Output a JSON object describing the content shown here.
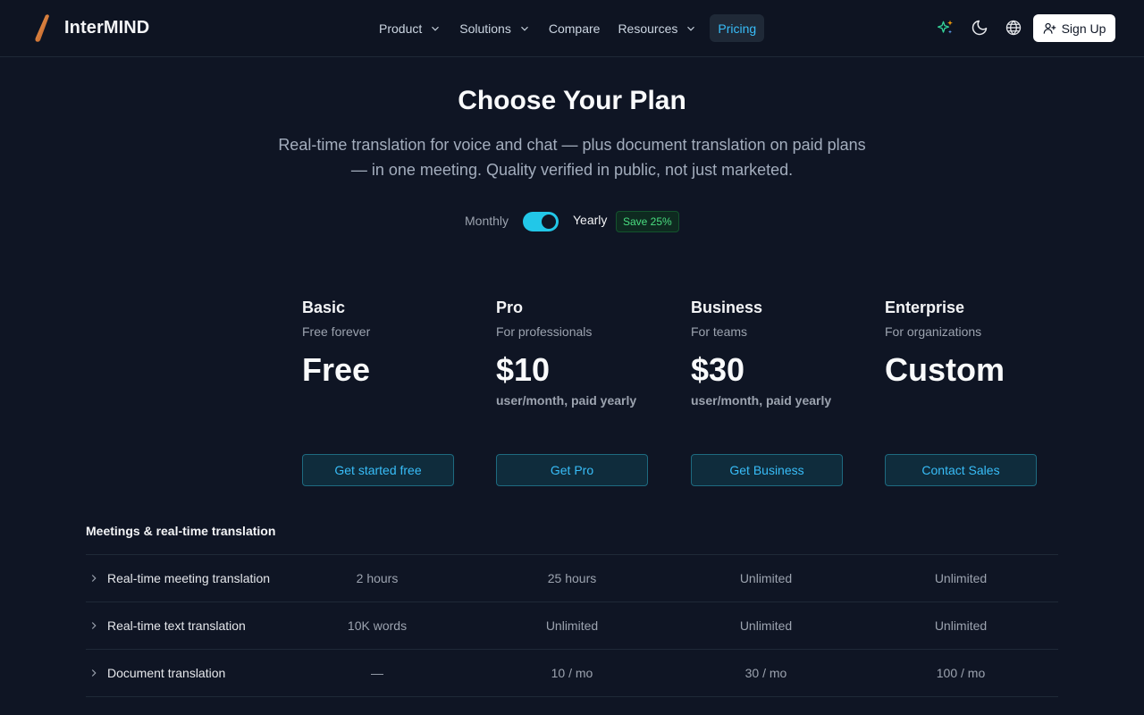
{
  "header": {
    "brand": "InterMIND",
    "nav": [
      {
        "label": "Product",
        "dropdown": true
      },
      {
        "label": "Solutions",
        "dropdown": true
      },
      {
        "label": "Compare",
        "dropdown": false
      },
      {
        "label": "Resources",
        "dropdown": true
      },
      {
        "label": "Pricing",
        "dropdown": false,
        "active": true
      }
    ],
    "icons": [
      "sparkles-icon",
      "moon-icon",
      "globe-icon"
    ],
    "signup_label": "Sign Up"
  },
  "hero": {
    "title": "Choose Your Plan",
    "subtitle_line1": "Real-time translation for voice and chat — plus document translation on paid plans",
    "subtitle_line2": "— in one meeting. Quality verified in public, not just marketed."
  },
  "billing": {
    "monthly_label": "Monthly",
    "yearly_label": "Yearly",
    "save_badge": "Save 25%",
    "yearly_selected": true
  },
  "plans": [
    {
      "name": "Basic",
      "desc": "Free forever",
      "price": "Free",
      "period": "",
      "cta": "Get started free"
    },
    {
      "name": "Pro",
      "desc": "For professionals",
      "price": "$10",
      "period": "user/month, paid yearly",
      "cta": "Get Pro"
    },
    {
      "name": "Business",
      "desc": "For teams",
      "price": "$30",
      "period": "user/month, paid yearly",
      "cta": "Get Business"
    },
    {
      "name": "Enterprise",
      "desc": "For organizations",
      "price": "Custom",
      "period": "",
      "cta": "Contact Sales"
    }
  ],
  "features": {
    "section_title": "Meetings & real-time translation",
    "rows": [
      {
        "label": "Real-time meeting translation",
        "values": [
          "2 hours",
          "25 hours",
          "Unlimited",
          "Unlimited"
        ]
      },
      {
        "label": "Real-time text translation",
        "values": [
          "10K words",
          "Unlimited",
          "Unlimited",
          "Unlimited"
        ]
      },
      {
        "label": "Document translation",
        "values": [
          "—",
          "10 / mo",
          "30 / mo",
          "100 / mo"
        ]
      }
    ]
  },
  "colors": {
    "background": "#0f1524",
    "accent": "#38bdf8",
    "toggle": "#22c7e8",
    "save_green": "#4ade80"
  }
}
